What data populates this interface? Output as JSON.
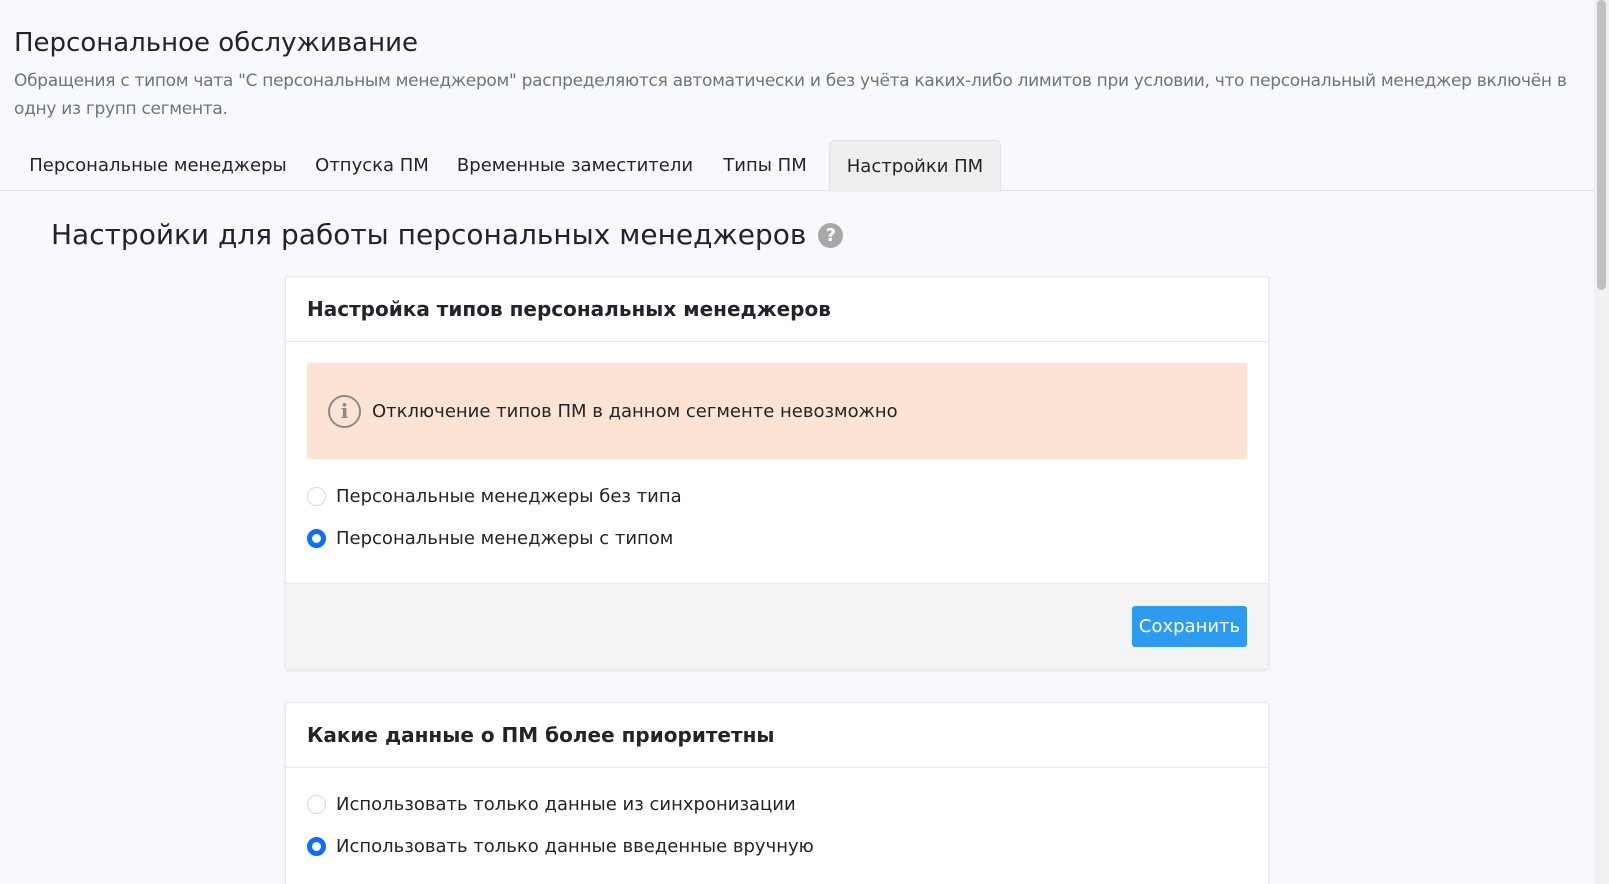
{
  "header": {
    "title": "Персональное обслуживание",
    "description": "Обращения с типом чата \"С персональным менеджером\" распределяются автоматически и без учёта каких-либо лимитов при условии, что персональный менеджер включён в одну из групп сегмента."
  },
  "tabs": [
    {
      "label": "Персональные менеджеры",
      "active": false
    },
    {
      "label": "Отпуска ПМ",
      "active": false
    },
    {
      "label": "Временные заместители",
      "active": false
    },
    {
      "label": "Типы ПМ",
      "active": false
    },
    {
      "label": "Настройки ПМ",
      "active": true
    }
  ],
  "section": {
    "title": "Настройки для работы персональных менеджеров",
    "help_icon": "question-circle-icon"
  },
  "card_types": {
    "title": "Настройка типов персональных менеджеров",
    "alert": {
      "icon": "info-icon",
      "text": "Отключение типов ПМ в данном сегменте невозможно",
      "color": "#fde3d3"
    },
    "options": [
      {
        "label": "Персональные менеджеры без типа",
        "checked": false
      },
      {
        "label": "Персональные менеджеры с типом",
        "checked": true
      }
    ],
    "save_label": "Сохранить"
  },
  "card_priority": {
    "title": "Какие данные о ПМ более приоритетны",
    "options": [
      {
        "label": "Использовать только данные из синхронизации",
        "checked": false
      },
      {
        "label": "Использовать только данные введенные вручную",
        "checked": true
      }
    ]
  },
  "colors": {
    "accent": "#0d6efd",
    "button": "#2d9cf0"
  }
}
